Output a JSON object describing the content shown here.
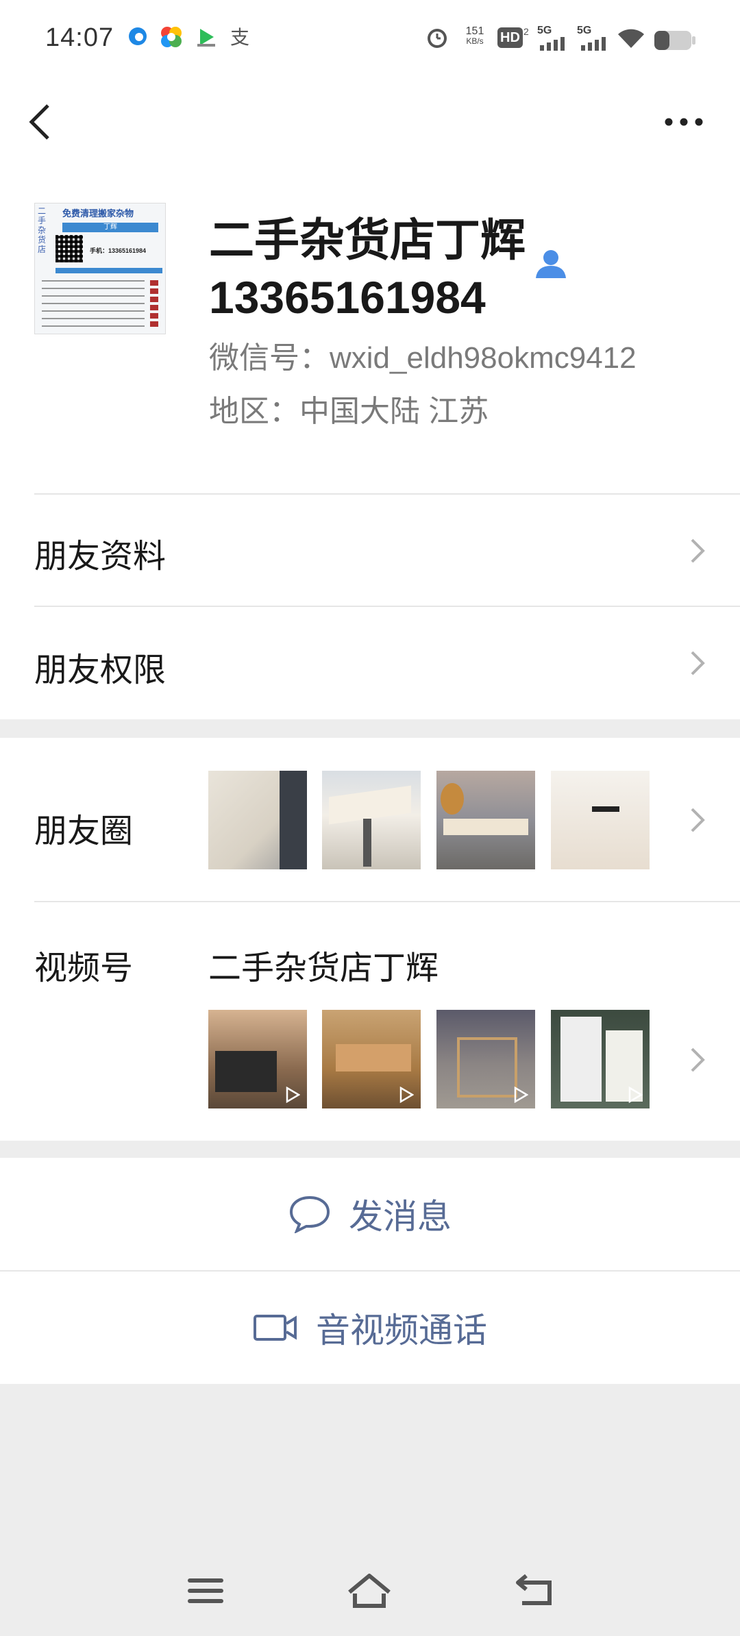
{
  "status_bar": {
    "time": "14:07",
    "net_speed_value": "151",
    "net_speed_unit": "KB/s",
    "hd_label": "HD",
    "hd_sub": "2",
    "signal1_label": "5G",
    "signal2_label": "5G",
    "app_icons": [
      "edge-browser-icon",
      "multicolor-app-icon",
      "video-app-icon",
      "alipay-icon"
    ]
  },
  "header": {
    "back_icon": "chevron-left-icon",
    "more_icon": "more-dots-icon"
  },
  "profile": {
    "name": "二手杂货店丁辉13365161984",
    "wechat_id": "微信号：wxid_eldh98okmc9412",
    "region": "地区：中国大陆 江苏",
    "avatar_title": "免费清理搬家杂物",
    "avatar_tag": "丁辉",
    "avatar_phone": "手机：13365161984"
  },
  "menu": {
    "friend_info": "朋友资料",
    "friend_permissions": "朋友权限"
  },
  "moments": {
    "label": "朋友圈"
  },
  "channels": {
    "label": "视频号",
    "name": "二手杂货店丁辉"
  },
  "actions": {
    "send_message": "发消息",
    "video_call": "音视频通话"
  },
  "colors": {
    "link": "#576b95",
    "bg": "#ededed",
    "text": "#191919",
    "secondary": "#7a7a7a",
    "contact_icon": "#4b8ee6"
  }
}
